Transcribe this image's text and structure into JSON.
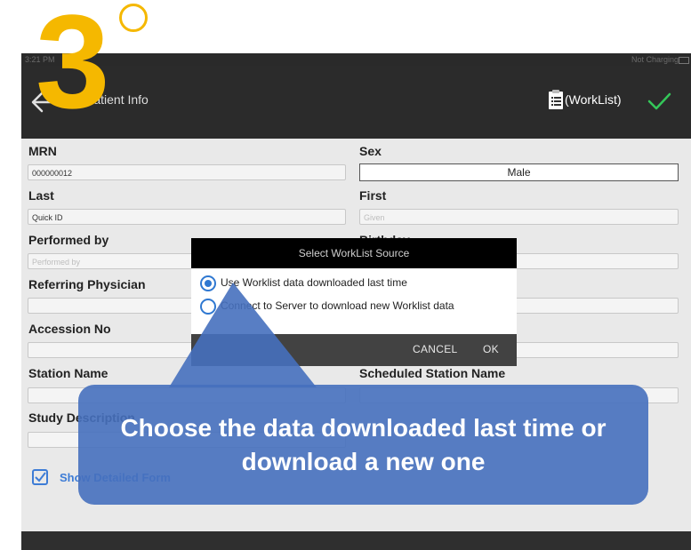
{
  "step": {
    "number": "3"
  },
  "statusbar": {
    "time": "3:21 PM",
    "charge": "Not Charging"
  },
  "nav": {
    "title": "Edit Patient Info",
    "worklist": "(WorkList)"
  },
  "form": {
    "mrn": {
      "label": "MRN",
      "value": "000000012"
    },
    "sex": {
      "label": "Sex",
      "value": "Male"
    },
    "last": {
      "label": "Last",
      "value": "Quick ID"
    },
    "first": {
      "label": "First",
      "placeholder": "Given"
    },
    "performed_by": {
      "label": "Performed by",
      "placeholder": "Performed by"
    },
    "birthday": {
      "label": "Birthday"
    },
    "referring": {
      "label": "Referring Physician"
    },
    "accession": {
      "label": "Accession No"
    },
    "station": {
      "label": "Station Name"
    },
    "scheduled_station": {
      "label": "Scheduled Station Name"
    },
    "study": {
      "label": "Study Description"
    },
    "show_detailed": "Show Detailed Form"
  },
  "dialog": {
    "title": "Select WorkList Source",
    "options": [
      {
        "label": "Use Worklist data downloaded last time",
        "selected": true
      },
      {
        "label": "Connect to Server to download new Worklist data",
        "selected": false
      }
    ],
    "cancel": "CANCEL",
    "ok": "OK"
  },
  "callout": {
    "text": "Choose the data downloaded last time or download a new one"
  },
  "colors": {
    "accent": "#2f78d1",
    "check": "#34c759",
    "step": "#f5b800",
    "callout": "#4670be"
  }
}
